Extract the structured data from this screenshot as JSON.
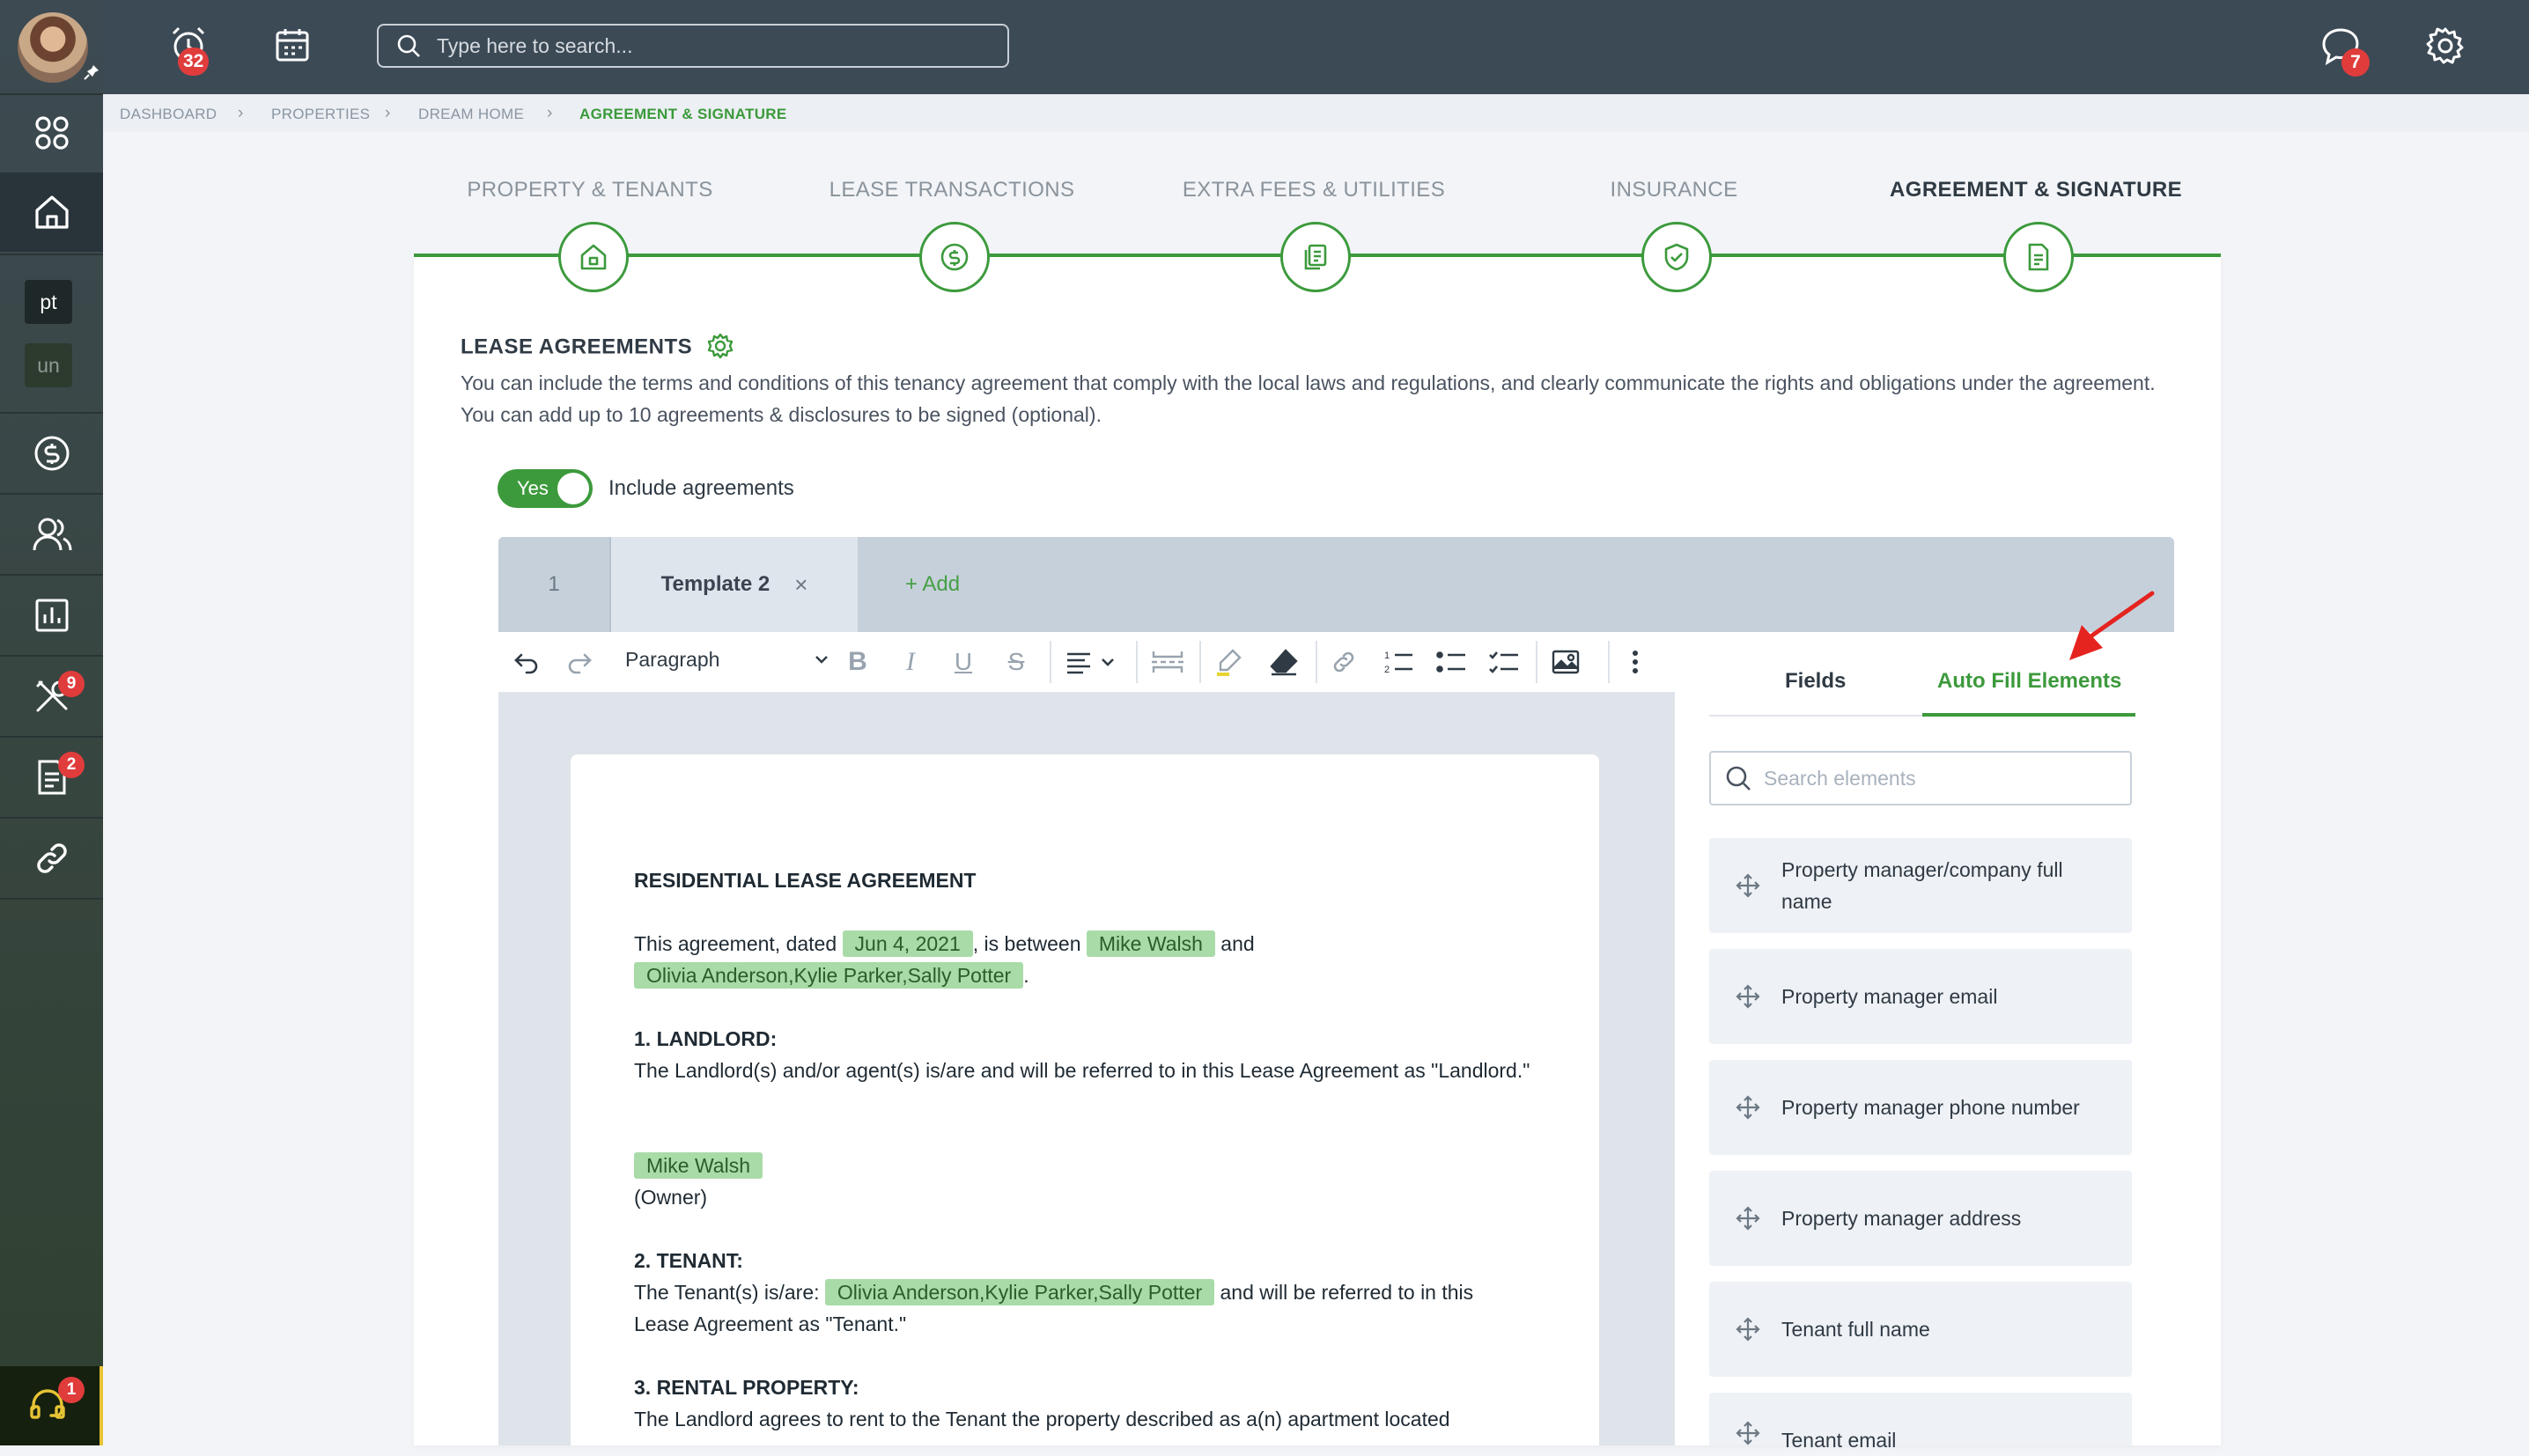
{
  "topbar": {
    "search_placeholder": "Type here to search...",
    "alarm_badge": "32",
    "chat_badge": "7"
  },
  "sidebar": {
    "workspace_1": "pt",
    "workspace_2": "un",
    "maintenance_badge": "9",
    "documents_badge": "2",
    "support_badge": "1"
  },
  "breadcrumb": [
    "DASHBOARD",
    "PROPERTIES",
    "DREAM HOME",
    "AGREEMENT & SIGNATURE"
  ],
  "steps": [
    "PROPERTY & TENANTS",
    "LEASE TRANSACTIONS",
    "EXTRA FEES & UTILITIES",
    "INSURANCE",
    "AGREEMENT & SIGNATURE"
  ],
  "section": {
    "title": "LEASE AGREEMENTS",
    "description": "You can include the terms and conditions of this tenancy agreement that comply with the local laws and regulations, and clearly communicate the rights and obligations under the agreement. You can add up to 10 agreements & disclosures to be signed (optional).",
    "toggle_value": "Yes",
    "toggle_label": "Include agreements"
  },
  "doc_tabs": {
    "tab1": "1",
    "tab2": "Template 2",
    "close": "×",
    "add": "+ Add"
  },
  "editor": {
    "paragraph_style": "Paragraph"
  },
  "document": {
    "title": "RESIDENTIAL LEASE AGREEMENT",
    "intro_1": "This agreement, dated",
    "date": "Jun 4, 2021",
    "intro_2": ", is between",
    "landlord_name": "Mike Walsh",
    "intro_3": "and",
    "tenants": "Olivia Anderson,Kylie Parker,Sally Potter",
    "period": ".",
    "landlord_heading": "1. LANDLORD:",
    "landlord_text": "The Landlord(s) and/or agent(s) is/are and will be referred to in this Lease Agreement as \"Landlord.\"",
    "owner_label": "(Owner)",
    "tenant_heading": "2. TENANT:",
    "tenant_text_1": "The Tenant(s) is/are:",
    "tenant_text_2": "and will be referred to in this Lease Agreement as \"Tenant.\"",
    "rental_heading": "3. RENTAL PROPERTY:",
    "rental_text": "The Landlord agrees to rent to the Tenant the property described as a(n) apartment located"
  },
  "right_panel": {
    "tab_fields": "Fields",
    "tab_auto_fill": "Auto Fill Elements",
    "search_placeholder": "Search elements",
    "elements": [
      "Property manager/company full name",
      "Property manager email",
      "Property manager phone number",
      "Property manager address",
      "Tenant full name",
      "Tenant email"
    ]
  },
  "colors": {
    "accent": "#3c9a3c",
    "chip": "#a9dba9",
    "badge": "#e03c3c",
    "topbar": "#3c4a56"
  }
}
